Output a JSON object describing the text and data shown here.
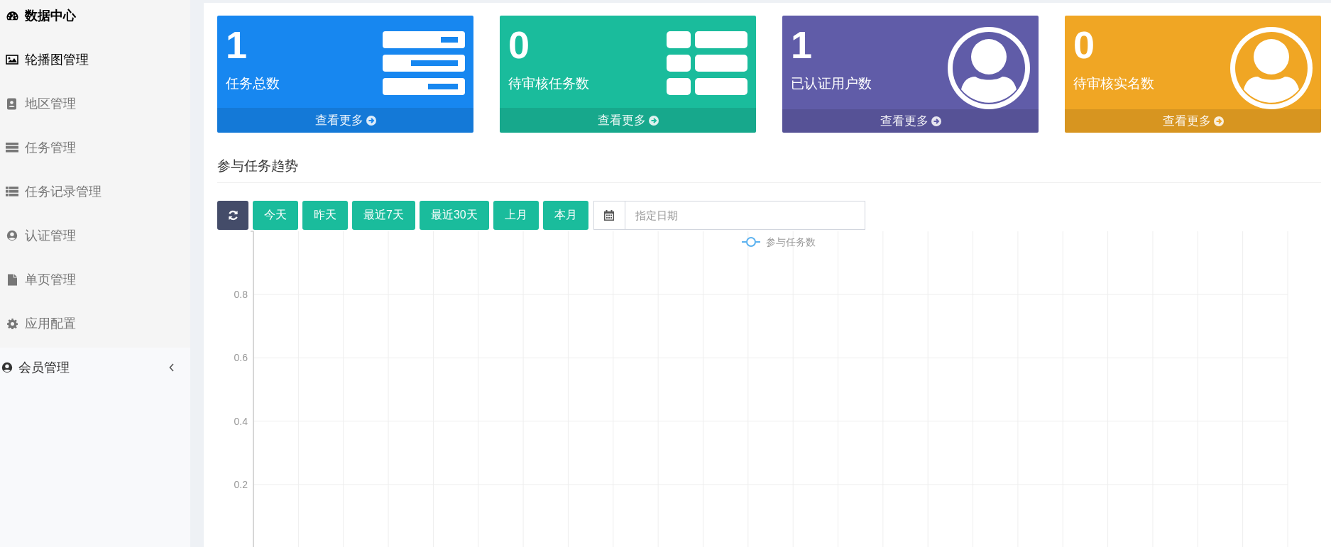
{
  "sidebar": {
    "items": [
      {
        "label": "数据中心",
        "selected": true,
        "highlighted": true
      },
      {
        "label": "轮播图管理",
        "selected": false,
        "highlighted": true
      },
      {
        "label": "地区管理",
        "selected": false,
        "highlighted": false
      },
      {
        "label": "任务管理",
        "selected": false,
        "highlighted": false
      },
      {
        "label": "任务记录管理",
        "selected": false,
        "highlighted": false
      },
      {
        "label": "认证管理",
        "selected": false,
        "highlighted": false
      },
      {
        "label": "单页管理",
        "selected": false,
        "highlighted": false
      },
      {
        "label": "应用配置",
        "selected": false,
        "highlighted": false
      }
    ],
    "group": {
      "label": "会员管理",
      "expanded": false
    }
  },
  "cards": [
    {
      "value": "1",
      "label": "任务总数",
      "link": "查看更多",
      "color": "#1787f0"
    },
    {
      "value": "0",
      "label": "待审核任务数",
      "link": "查看更多",
      "color": "#1abc9c"
    },
    {
      "value": "1",
      "label": "已认证用户数",
      "link": "查看更多",
      "color": "#605ca8"
    },
    {
      "value": "0",
      "label": "待审核实名数",
      "link": "查看更多",
      "color": "#f0a624"
    }
  ],
  "section_title": "参与任务趋势",
  "toolbar": {
    "buttons": [
      "今天",
      "昨天",
      "最近7天",
      "最近30天",
      "上月",
      "本月"
    ],
    "date_field": {
      "placeholder": "指定日期"
    }
  },
  "chart": {
    "chart_data": {
      "type": "line",
      "grid": true,
      "ylim": [
        0,
        1
      ],
      "yticks": [
        0.2,
        0.4,
        0.6,
        0.8
      ],
      "series": [
        {
          "name": "参与任务数",
          "color": "#5ab1ef"
        }
      ]
    }
  }
}
